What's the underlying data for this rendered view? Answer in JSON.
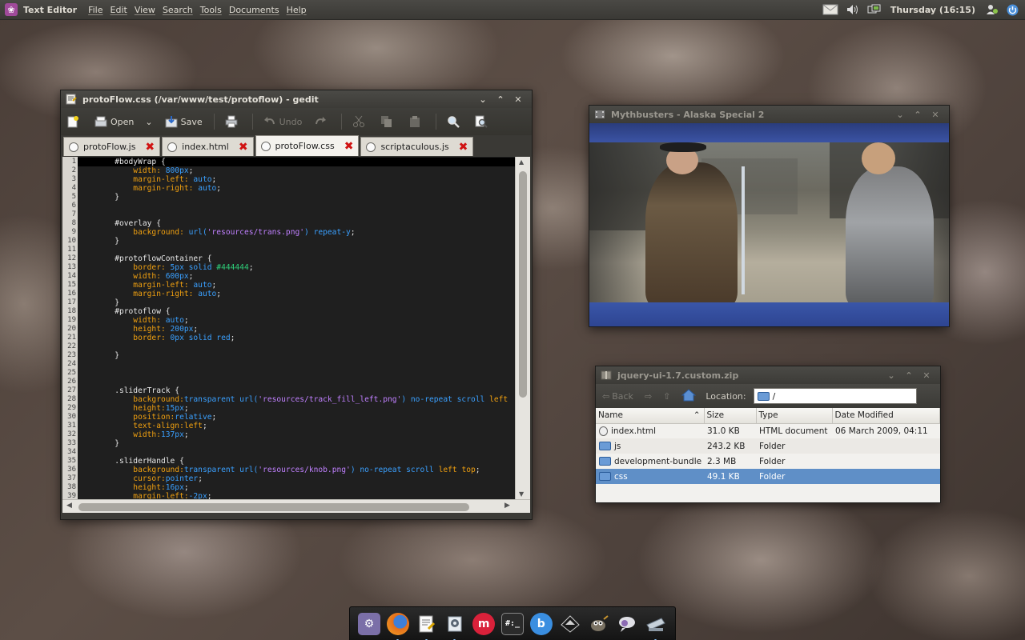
{
  "top_panel": {
    "app_title": "Text Editor",
    "menus": [
      "File",
      "Edit",
      "View",
      "Search",
      "Tools",
      "Documents",
      "Help"
    ],
    "clock": "Thursday (16:15)"
  },
  "gedit": {
    "title": "protoFlow.css (/var/www/test/protoflow) - gedit",
    "toolbar": {
      "open_label": "Open",
      "save_label": "Save",
      "undo_label": "Undo"
    },
    "tabs": [
      {
        "label": "protoFlow.js",
        "active": false
      },
      {
        "label": "index.html",
        "active": false
      },
      {
        "label": "protoFlow.css",
        "active": true
      },
      {
        "label": "scriptaculous.js",
        "active": false
      }
    ],
    "code_lines": [
      [
        [
          "sel",
          "        #bodyWrap {"
        ]
      ],
      [
        [
          "prop",
          "            width: "
        ],
        [
          "num",
          "800px"
        ],
        [
          "sel",
          ";"
        ]
      ],
      [
        [
          "prop",
          "            margin-left: "
        ],
        [
          "val",
          "auto"
        ],
        [
          "sel",
          ";"
        ]
      ],
      [
        [
          "prop",
          "            margin-right: "
        ],
        [
          "val",
          "auto"
        ],
        [
          "sel",
          ";"
        ]
      ],
      [
        [
          "sel",
          "        }"
        ]
      ],
      [
        [
          "sel",
          ""
        ]
      ],
      [
        [
          "sel",
          ""
        ]
      ],
      [
        [
          "sel",
          "        #overlay {"
        ]
      ],
      [
        [
          "prop",
          "            background: "
        ],
        [
          "val",
          "url("
        ],
        [
          "str",
          "'resources/trans.png'"
        ],
        [
          "val",
          ") repeat-y"
        ],
        [
          "sel",
          ";"
        ]
      ],
      [
        [
          "sel",
          "        }"
        ]
      ],
      [
        [
          "sel",
          ""
        ]
      ],
      [
        [
          "sel",
          "        #protoflowContainer {"
        ]
      ],
      [
        [
          "prop",
          "            border: "
        ],
        [
          "num",
          "5px"
        ],
        [
          "val",
          " solid "
        ],
        [
          "gr",
          "#444444"
        ],
        [
          "sel",
          ";"
        ]
      ],
      [
        [
          "prop",
          "            width: "
        ],
        [
          "num",
          "600px"
        ],
        [
          "sel",
          ";"
        ]
      ],
      [
        [
          "prop",
          "            margin-left: "
        ],
        [
          "val",
          "auto"
        ],
        [
          "sel",
          ";"
        ]
      ],
      [
        [
          "prop",
          "            margin-right: "
        ],
        [
          "val",
          "auto"
        ],
        [
          "sel",
          ";"
        ]
      ],
      [
        [
          "sel",
          "        }"
        ]
      ],
      [
        [
          "sel",
          "        #protoflow {"
        ]
      ],
      [
        [
          "prop",
          "            width: "
        ],
        [
          "val",
          "auto"
        ],
        [
          "sel",
          ";"
        ]
      ],
      [
        [
          "prop",
          "            height: "
        ],
        [
          "num",
          "200px"
        ],
        [
          "sel",
          ";"
        ]
      ],
      [
        [
          "prop",
          "            border: "
        ],
        [
          "num",
          "0px"
        ],
        [
          "val",
          " solid red"
        ],
        [
          "sel",
          ";"
        ]
      ],
      [
        [
          "sel",
          ""
        ]
      ],
      [
        [
          "sel",
          "        }"
        ]
      ],
      [
        [
          "sel",
          ""
        ]
      ],
      [
        [
          "sel",
          ""
        ]
      ],
      [
        [
          "sel",
          ""
        ]
      ],
      [
        [
          "sel",
          "        .sliderTrack {"
        ]
      ],
      [
        [
          "prop",
          "            background:"
        ],
        [
          "val",
          "transparent url("
        ],
        [
          "str",
          "'resources/track_fill_left.png'"
        ],
        [
          "val",
          ") no-repeat scroll "
        ],
        [
          "prop",
          "left"
        ]
      ],
      [
        [
          "prop",
          "            height:"
        ],
        [
          "num",
          "15px"
        ],
        [
          "sel",
          ";"
        ]
      ],
      [
        [
          "prop",
          "            position:"
        ],
        [
          "val",
          "relative"
        ],
        [
          "sel",
          ";"
        ]
      ],
      [
        [
          "prop",
          "            text-align:"
        ],
        [
          "prop",
          "left"
        ],
        [
          "sel",
          ";"
        ]
      ],
      [
        [
          "prop",
          "            width:"
        ],
        [
          "num",
          "137px"
        ],
        [
          "sel",
          ";"
        ]
      ],
      [
        [
          "sel",
          "        }"
        ]
      ],
      [
        [
          "sel",
          ""
        ]
      ],
      [
        [
          "sel",
          "        .sliderHandle {"
        ]
      ],
      [
        [
          "prop",
          "            background:"
        ],
        [
          "val",
          "transparent url("
        ],
        [
          "str",
          "'resources/knob.png'"
        ],
        [
          "val",
          ") no-repeat scroll "
        ],
        [
          "prop",
          "left top"
        ],
        [
          "sel",
          ";"
        ]
      ],
      [
        [
          "prop",
          "            cursor:"
        ],
        [
          "val",
          "pointer"
        ],
        [
          "sel",
          ";"
        ]
      ],
      [
        [
          "prop",
          "            height:"
        ],
        [
          "num",
          "16px"
        ],
        [
          "sel",
          ";"
        ]
      ],
      [
        [
          "prop",
          "            margin-left:"
        ],
        [
          "num",
          "-2px"
        ],
        [
          "sel",
          ";"
        ]
      ]
    ]
  },
  "video_window": {
    "title": "Mythbusters - Alaska Special 2"
  },
  "archive_window": {
    "title": "jquery-ui-1.7.custom.zip",
    "back_label": "Back",
    "location_label": "Location:",
    "location_value": "/",
    "columns": [
      "Name",
      "Size",
      "Type",
      "Date Modified"
    ],
    "rows": [
      {
        "name": "index.html",
        "size": "31.0 KB",
        "type": "HTML document",
        "date": "06 March 2009, 04:11",
        "kind": "file"
      },
      {
        "name": "js",
        "size": "243.2 KB",
        "type": "Folder",
        "date": "",
        "kind": "folder"
      },
      {
        "name": "development-bundle",
        "size": "2.3 MB",
        "type": "Folder",
        "date": "",
        "kind": "folder"
      },
      {
        "name": "css",
        "size": "49.1 KB",
        "type": "Folder",
        "date": "",
        "kind": "folder",
        "selected": true
      }
    ]
  },
  "dock": {
    "items": [
      {
        "name": "settings-icon",
        "color": "#7b6fa8",
        "glyph": "⚙",
        "running": false
      },
      {
        "name": "firefox-icon",
        "color": "#e36d1d",
        "glyph": "",
        "running": true
      },
      {
        "name": "text-editor-icon",
        "color": "#d8d4c8",
        "glyph": "",
        "running": true
      },
      {
        "name": "media-player-icon",
        "color": "#cfd6de",
        "glyph": "",
        "running": true
      },
      {
        "name": "miro-icon",
        "color": "#d9213a",
        "glyph": "m",
        "running": false
      },
      {
        "name": "terminal-icon",
        "color": "#2b2b2b",
        "glyph": "#:_",
        "running": false
      },
      {
        "name": "bluetooth-icon",
        "color": "#3a8ee0",
        "glyph": "b",
        "running": false
      },
      {
        "name": "inkscape-icon",
        "color": "#333",
        "glyph": "◆",
        "running": false
      },
      {
        "name": "gimp-icon",
        "color": "#6f6a5e",
        "glyph": "",
        "running": false
      },
      {
        "name": "pidgin-icon",
        "color": "#8c6bb3",
        "glyph": "",
        "running": false
      },
      {
        "name": "scanner-icon",
        "color": "#9aa8b6",
        "glyph": "",
        "running": true
      }
    ]
  }
}
